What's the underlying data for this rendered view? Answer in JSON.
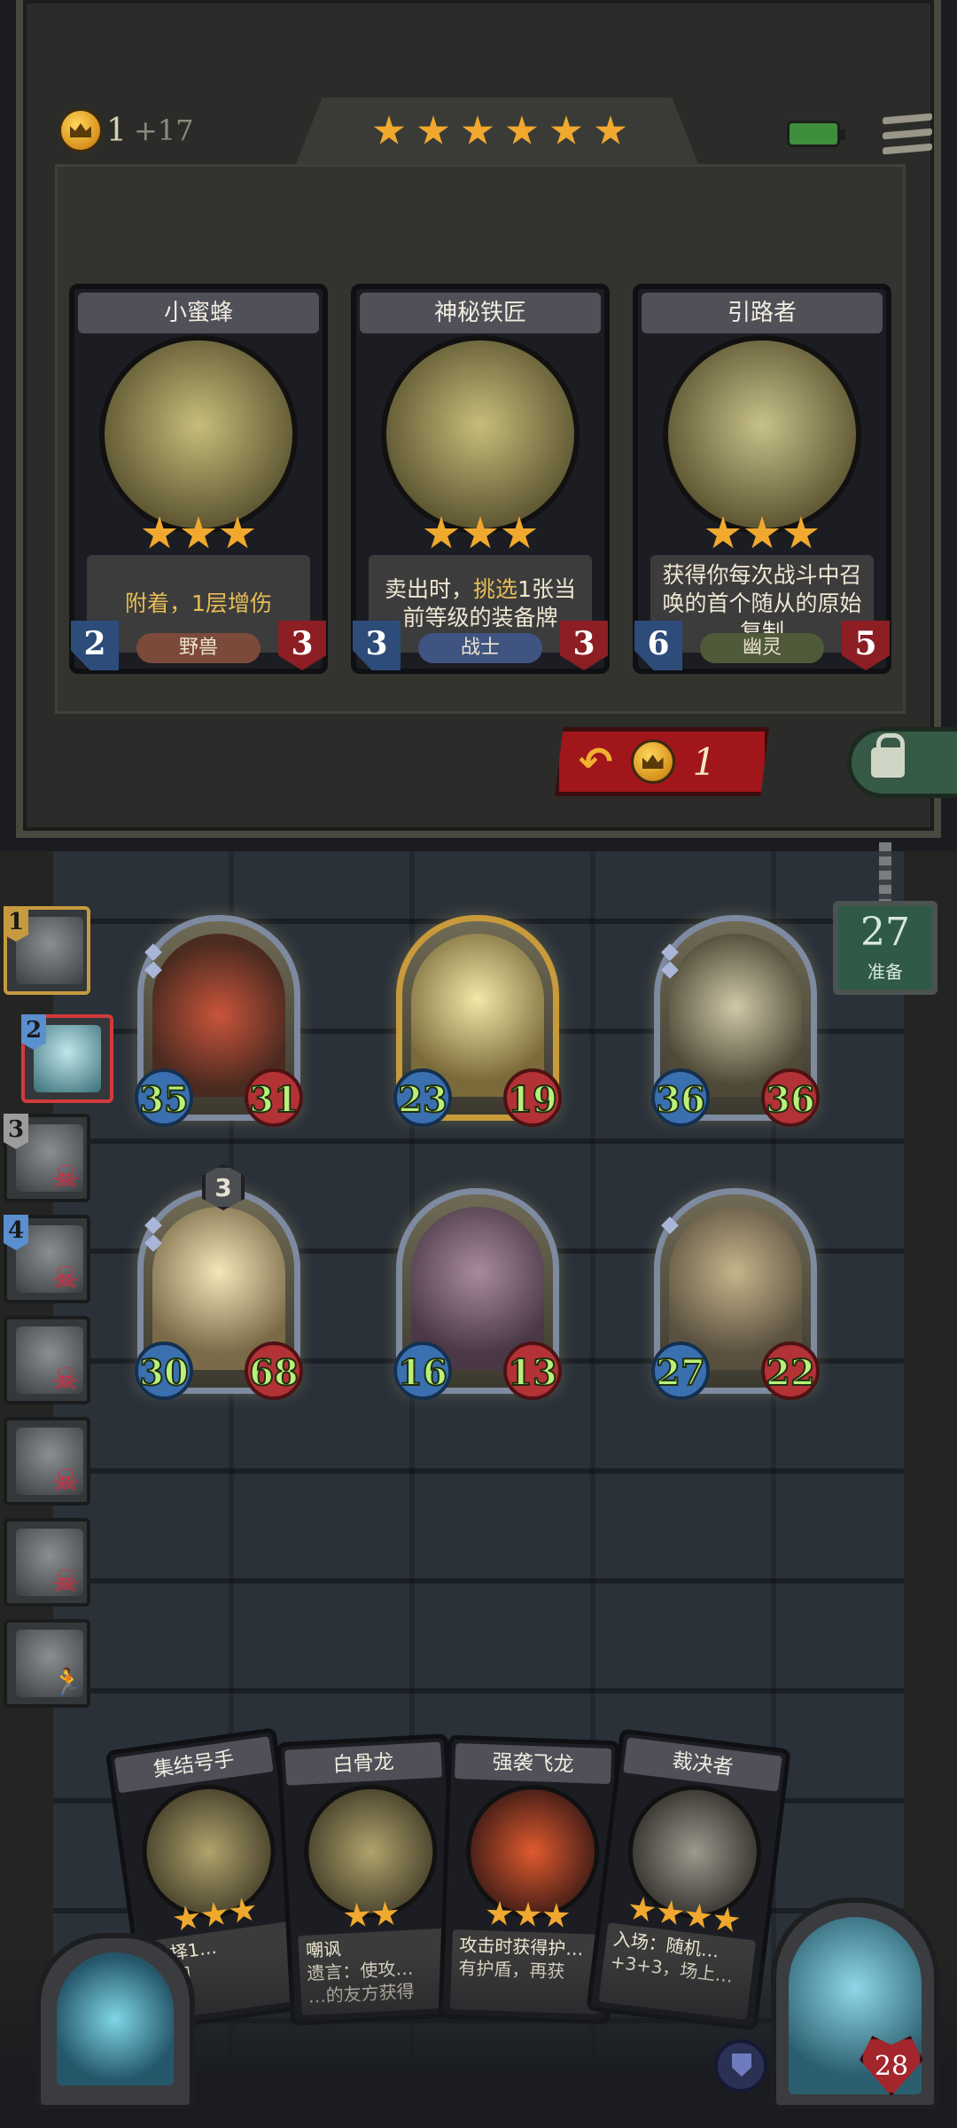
{
  "shop": {
    "gold": "1",
    "gold_income": "+17",
    "tavern_stars": 6,
    "cards": [
      {
        "name": "小蜜蜂",
        "stars": 3,
        "desc_parts": [
          "附着，1层",
          "增伤"
        ],
        "attack": "2",
        "health": "3",
        "tribe": "野兽",
        "tribe_color": "#7c4a3a"
      },
      {
        "name": "神秘铁匠",
        "stars": 3,
        "desc_parts": [
          "卖出时，",
          "挑选",
          "1张当前等级的装备牌"
        ],
        "attack": "3",
        "health": "3",
        "tribe": "战士",
        "tribe_color": "#3f5480"
      },
      {
        "name": "引路者",
        "stars": 3,
        "desc_parts": [
          "获得你每次战斗中召唤的首个随从的原始复制"
        ],
        "attack": "6",
        "health": "5",
        "tribe": "幽灵",
        "tribe_color": "#4f5a3a"
      }
    ],
    "reroll_cost": "1"
  },
  "turn": {
    "number": "27",
    "label": "准备"
  },
  "players": [
    {
      "rank": "1",
      "status": "alive",
      "rank_color": "gold"
    },
    {
      "rank": "2",
      "status": "you",
      "rank_color": "blue"
    },
    {
      "rank": "3",
      "status": "dead",
      "rank_color": "grey"
    },
    {
      "rank": "4",
      "status": "dead",
      "rank_color": "blue"
    },
    {
      "rank": "",
      "status": "dead"
    },
    {
      "rank": "",
      "status": "dead"
    },
    {
      "rank": "",
      "status": "dead"
    },
    {
      "rank": "",
      "status": "fled"
    }
  ],
  "board": [
    {
      "attack": "35",
      "health": "31"
    },
    {
      "attack": "23",
      "health": "19"
    },
    {
      "attack": "36",
      "health": "36"
    },
    {
      "attack": "30",
      "health": "68",
      "level": "3"
    },
    {
      "attack": "16",
      "health": "13"
    },
    {
      "attack": "27",
      "health": "22"
    }
  ],
  "hand": [
    {
      "name": "集结号手",
      "stars": 3,
      "desc": "选择1…\n…同"
    },
    {
      "name": "白骨龙",
      "stars": 2,
      "desc": "嘲讽\n遗言：使攻…\n…的友方获得"
    },
    {
      "name": "强袭飞龙",
      "stars": 3,
      "desc": "攻击时获得护…\n有护盾，再获"
    },
    {
      "name": "裁决者",
      "stars": 4,
      "desc": "入场：随机…\n+3+3，场上…"
    }
  ],
  "hero": {
    "health": "28"
  },
  "colors": {
    "star": "#f0a92e",
    "stat_green": "#b9f07a",
    "reroll_red": "#a0161b"
  }
}
